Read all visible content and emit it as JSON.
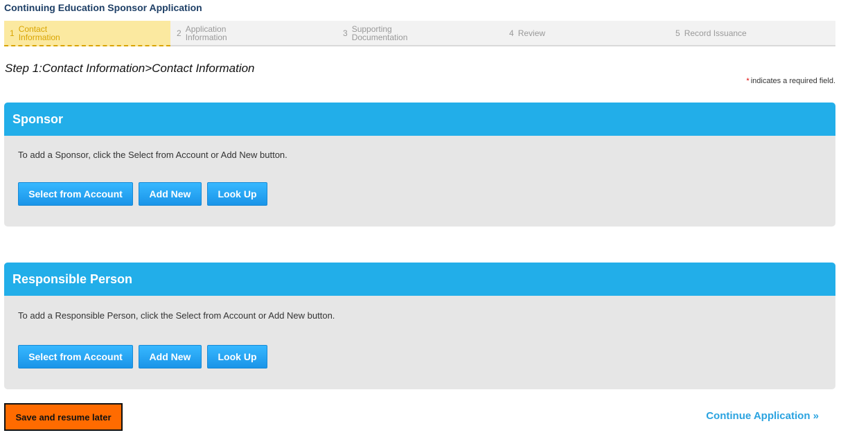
{
  "app_title": "Continuing Education Sponsor Application",
  "steps": [
    {
      "num": "1",
      "label_line1": "Contact",
      "label_line2": "Information"
    },
    {
      "num": "2",
      "label_line1": "Application",
      "label_line2": "Information"
    },
    {
      "num": "3",
      "label_line1": "Supporting",
      "label_line2": "Documentation"
    },
    {
      "num": "4",
      "label_line1": "Review",
      "label_line2": ""
    },
    {
      "num": "5",
      "label_line1": "Record Issuance",
      "label_line2": ""
    }
  ],
  "breadcrumb": "Step 1:Contact Information>Contact Information",
  "required_note": {
    "star": "*",
    "text": "indicates a required field."
  },
  "sponsor": {
    "title": "Sponsor",
    "instructions": "To add a Sponsor, click the Select from Account or Add New button.",
    "select_label": "Select from Account",
    "add_label": "Add New",
    "lookup_label": "Look Up"
  },
  "responsible": {
    "title": "Responsible Person",
    "instructions": "To add a Responsible Person, click the Select from Account or Add New button.",
    "select_label": "Select from Account",
    "add_label": "Add New",
    "lookup_label": "Look Up"
  },
  "footer": {
    "save_label": "Save and resume later",
    "continue_label": "Continue Application »"
  },
  "colors": {
    "accent": "#22aee9",
    "active_step": "#fbe9a0",
    "save_button": "#ff6b00"
  }
}
